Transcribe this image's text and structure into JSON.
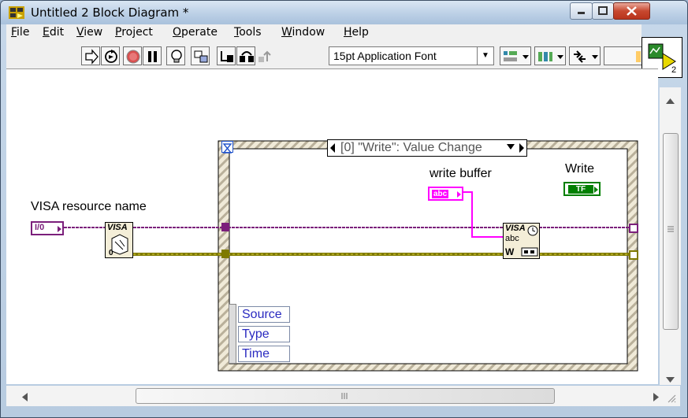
{
  "window": {
    "title": "Untitled 2 Block Diagram *"
  },
  "menu": {
    "items": [
      {
        "key": "F",
        "rest": "ile"
      },
      {
        "key": "E",
        "rest": "dit"
      },
      {
        "key": "V",
        "rest": "iew"
      },
      {
        "key": "P",
        "rest": "roject"
      },
      {
        "key": "O",
        "rest": "perate"
      },
      {
        "key": "T",
        "rest": "ools"
      },
      {
        "key": "W",
        "rest": "indow"
      },
      {
        "key": "H",
        "rest": "elp"
      }
    ]
  },
  "toolbar": {
    "font_selector": "15pt Application Font"
  },
  "diagram": {
    "visa_label": "VISA resource name",
    "visa_terminal": "I/0",
    "visa_open_text": "VISA",
    "write_buffer_label": "write buffer",
    "write_buffer_terminal": "abc",
    "write_label": "Write",
    "write_terminal": "TF",
    "case_selector": "[0] \"Write\": Value Change",
    "event_data": [
      "Source",
      "Type",
      "Time"
    ],
    "visa_write_text": "VISA",
    "visa_write_abc": "abc",
    "visa_write_w": "W"
  },
  "colors": {
    "visa_wire": "#7b1f7b",
    "error_wire": "#7f7a00",
    "string_wire": "#ff00ff",
    "bool_wire": "#007f00",
    "structure_frame": "#2c2c2c",
    "structure_fill": "#e8e0c8"
  }
}
